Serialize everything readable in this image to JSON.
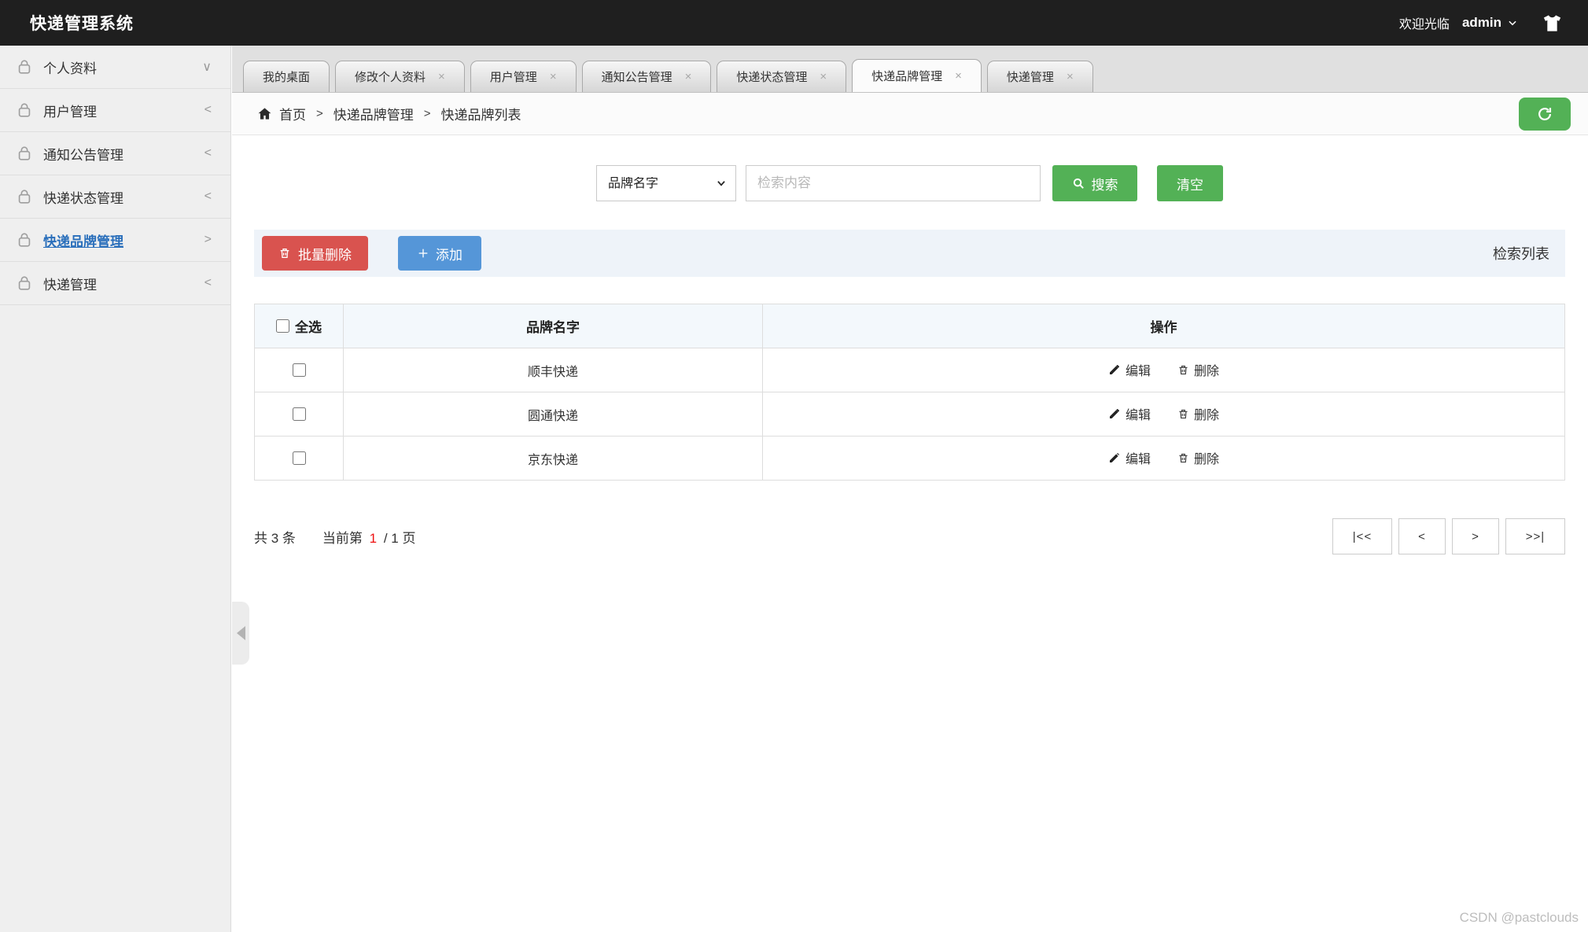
{
  "header": {
    "title": "快递管理系统",
    "welcome": "欢迎光临",
    "username": "admin"
  },
  "sidebar": {
    "items": [
      {
        "label": "个人资料",
        "chevron": "∨",
        "active": false
      },
      {
        "label": "用户管理",
        "chevron": "<",
        "active": false
      },
      {
        "label": "通知公告管理",
        "chevron": "<",
        "active": false
      },
      {
        "label": "快递状态管理",
        "chevron": "<",
        "active": false
      },
      {
        "label": "快递品牌管理",
        "chevron": ">",
        "active": true
      },
      {
        "label": "快递管理",
        "chevron": "<",
        "active": false
      }
    ]
  },
  "tabs": [
    {
      "label": "我的桌面",
      "closable": false,
      "active": false
    },
    {
      "label": "修改个人资料",
      "closable": true,
      "active": false
    },
    {
      "label": "用户管理",
      "closable": true,
      "active": false
    },
    {
      "label": "通知公告管理",
      "closable": true,
      "active": false
    },
    {
      "label": "快递状态管理",
      "closable": true,
      "active": false
    },
    {
      "label": "快递品牌管理",
      "closable": true,
      "active": true
    },
    {
      "label": "快递管理",
      "closable": true,
      "active": false
    }
  ],
  "icons": {
    "close": "×",
    "crumb_sep": ">"
  },
  "breadcrumb": {
    "items": [
      "首页",
      "快递品牌管理",
      "快递品牌列表"
    ]
  },
  "search": {
    "field_selected": "品牌名字",
    "placeholder": "检索内容",
    "search_label": "搜索",
    "clear_label": "清空"
  },
  "toolbar": {
    "batch_delete_label": "批量删除",
    "add_label": "添加",
    "list_title": "检索列表"
  },
  "table": {
    "select_all_label": "全选",
    "columns": {
      "brand": "品牌名字",
      "actions": "操作"
    },
    "edit_label": "编辑",
    "delete_label": "删除",
    "rows": [
      {
        "brand": "顺丰快递"
      },
      {
        "brand": "圆通快递"
      },
      {
        "brand": "京东快递"
      }
    ]
  },
  "pagination": {
    "total_text": "共 3 条",
    "current_prefix": "当前第",
    "current_page": "1",
    "page_suffix": "/ 1 页",
    "first_label": "|<<",
    "prev_label": "<",
    "next_label": ">",
    "last_label": ">>|"
  },
  "watermark": "CSDN @pastclouds",
  "colors": {
    "header_bg": "#1f1f1f",
    "green": "#53b156",
    "red": "#d9534f",
    "blue": "#5596d8",
    "active_link": "#2a6fbb",
    "current_page_red": "#ee1111"
  }
}
